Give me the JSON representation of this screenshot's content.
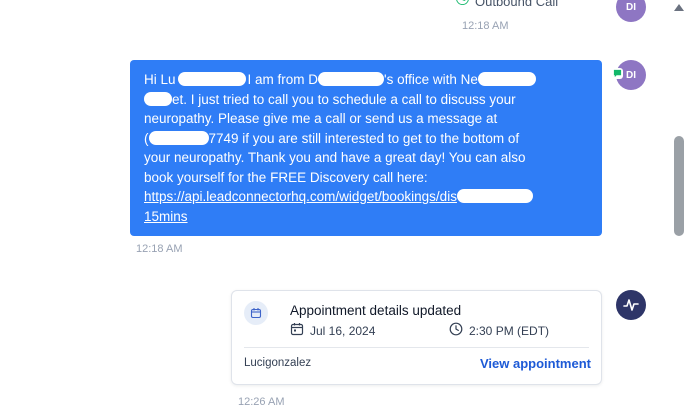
{
  "outbound": {
    "label": "Outbound Call",
    "time": "12:18 AM"
  },
  "avatar": {
    "initials": "DI"
  },
  "message": {
    "lines": [
      [
        "Hi Lu",
        "I am from D",
        "'s office with Ne"
      ],
      [
        "",
        "et. I just tried to call you to schedule a call to discuss your"
      ],
      [
        "neuropathy. Please give me a call or send us a message at"
      ],
      [
        "(",
        "7749 if you are still interested to get to the bottom of"
      ],
      [
        "your neuropathy. Thank you and have a great day! You can also"
      ],
      [
        "book yourself for the FREE Discovery call here:"
      ],
      [
        "https://api.leadconnectorhq.com/widget/bookings/dis"
      ],
      [
        "15mins"
      ]
    ],
    "time": "12:18 AM"
  },
  "appointment": {
    "title": "Appointment details updated",
    "date": "Jul 16, 2024",
    "time_range": "2:30 PM (EDT)",
    "user": "Lucigonzalez",
    "view_link": "View appointment",
    "timestamp": "12:26 AM"
  },
  "colors": {
    "bubble": "#2f7df6",
    "avatar": "#8e76c3",
    "activity_avatar": "#2e3568",
    "link": "#1d5ad6",
    "call_icon": "#12b76a"
  },
  "icons": {
    "outbound": "phone-icon",
    "channel": "sms-icon",
    "activity": "activity-icon",
    "calendar": "calendar-icon",
    "clock": "clock-icon"
  }
}
